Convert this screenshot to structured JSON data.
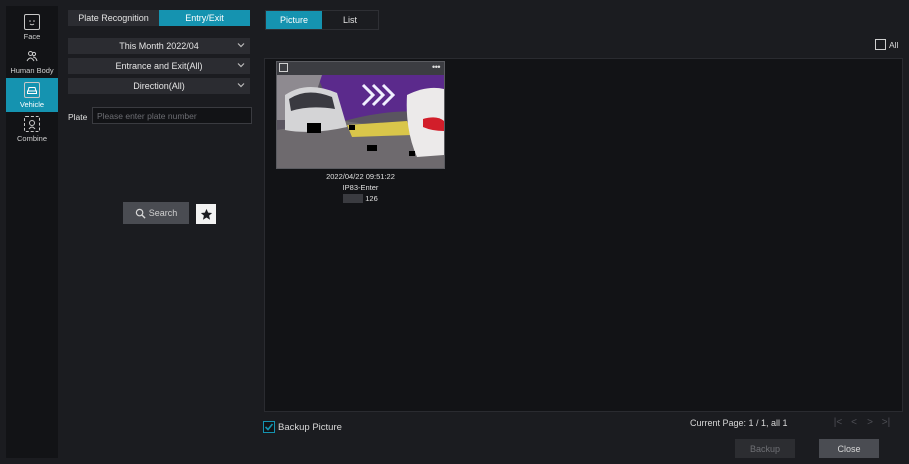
{
  "rail": {
    "items": [
      {
        "label": "Face",
        "icon": "face-icon"
      },
      {
        "label": "Human Body",
        "icon": "human-body-icon"
      },
      {
        "label": "Vehicle",
        "icon": "vehicle-icon",
        "active": true
      },
      {
        "label": "Combine",
        "icon": "combine-icon"
      }
    ]
  },
  "filter": {
    "tabs": [
      "Plate Recognition",
      "Entry/Exit"
    ],
    "active_tab": "Entry/Exit",
    "time_range": "This Month 2022/04",
    "entrance": "Entrance and Exit(All)",
    "direction": "Direction(All)",
    "plate_label": "Plate",
    "plate_placeholder": "Please enter plate number",
    "plate_value": "",
    "search_label": "Search"
  },
  "view": {
    "tabs": [
      "Picture",
      "List"
    ],
    "active_tab": "Picture",
    "select_all_label": "All"
  },
  "results": [
    {
      "timestamp": "2022/04/22 09:51:22",
      "camera": "IP83-Enter",
      "plate": "126"
    }
  ],
  "footer": {
    "backup_picture_label": "Backup Picture",
    "backup_picture_checked": true,
    "page_info": "Current Page: 1 / 1, all 1",
    "backup_button": "Backup",
    "close_button": "Close"
  },
  "colors": {
    "accent": "#1593b0",
    "background": "#1b1c20",
    "panel_dark": "#121316"
  }
}
